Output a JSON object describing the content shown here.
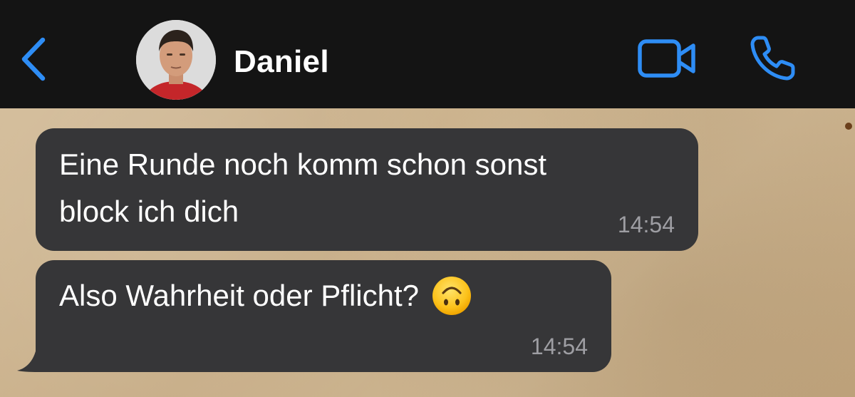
{
  "header": {
    "contact_name": "Daniel",
    "back_icon": "chevron-left-icon",
    "video_icon": "video-camera-icon",
    "call_icon": "phone-icon",
    "accent_color": "#2e8df5",
    "background_color": "#141414"
  },
  "chat": {
    "bubble_color": "#363638",
    "messages": [
      {
        "lines": [
          "Eine Runde noch komm schon sonst",
          "block ich dich"
        ],
        "time": "14:54",
        "direction": "incoming"
      },
      {
        "text": "Also Wahrheit oder Pflicht?",
        "emoji": "upside-down-face-emoji",
        "time": "14:54",
        "direction": "incoming"
      }
    ]
  }
}
